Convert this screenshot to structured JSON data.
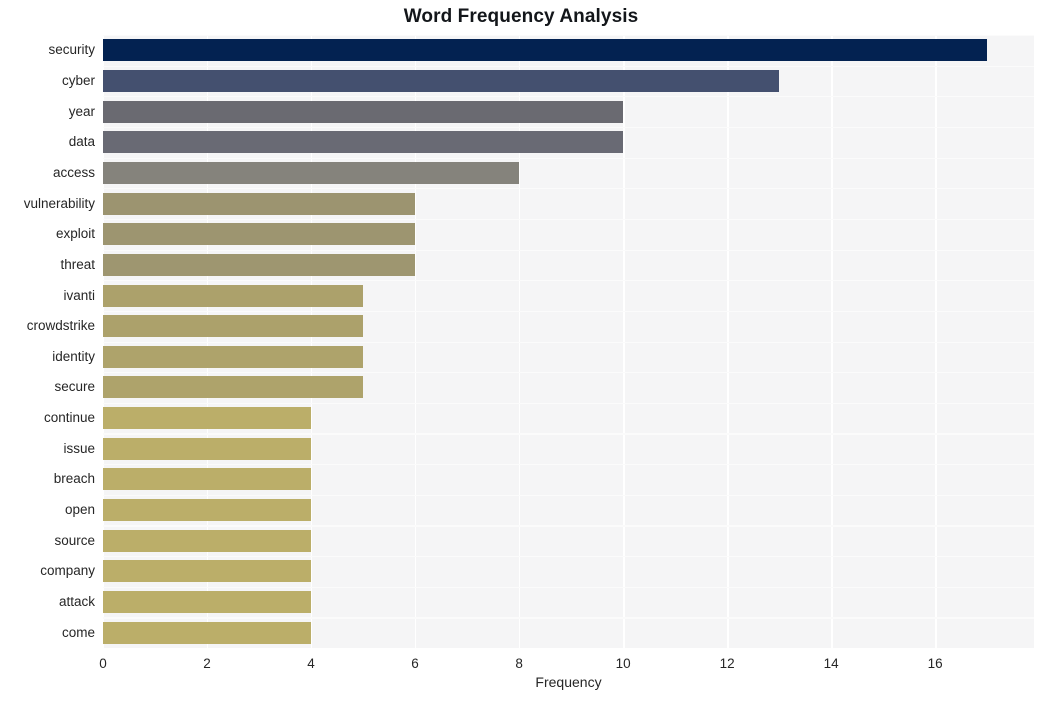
{
  "chart_data": {
    "type": "bar",
    "orientation": "horizontal",
    "title": "Word Frequency Analysis",
    "xlabel": "Frequency",
    "ylabel": "",
    "xlim": [
      0,
      17.9
    ],
    "xticks": [
      0,
      2,
      4,
      6,
      8,
      10,
      12,
      14,
      16
    ],
    "xtick_labels": [
      "0",
      "2",
      "4",
      "6",
      "8",
      "10",
      "12",
      "14",
      "16"
    ],
    "grid": true,
    "grid_axis": "both",
    "legend": false,
    "plot_background": "#f5f5f6",
    "figure_background": "#ffffff",
    "categories": [
      "security",
      "cyber",
      "year",
      "data",
      "access",
      "vulnerability",
      "exploit",
      "threat",
      "ivanti",
      "crowdstrike",
      "identity",
      "secure",
      "continue",
      "issue",
      "breach",
      "open",
      "source",
      "company",
      "attack",
      "come"
    ],
    "values": [
      17,
      13,
      10,
      10,
      8,
      6,
      6,
      6,
      5,
      5,
      5,
      5,
      4,
      4,
      4,
      4,
      4,
      4,
      4,
      4
    ],
    "bar_colors": [
      "#032251",
      "#44506f",
      "#6a6a71",
      "#696a74",
      "#85837c",
      "#9c9470",
      "#9d9570",
      "#9e9670",
      "#aca16b",
      "#aca16b",
      "#aea36b",
      "#aea36b",
      "#bbae69",
      "#bbae69",
      "#bbae69",
      "#bbae69",
      "#bbae69",
      "#bbae69",
      "#bbae69",
      "#bbae69"
    ]
  }
}
